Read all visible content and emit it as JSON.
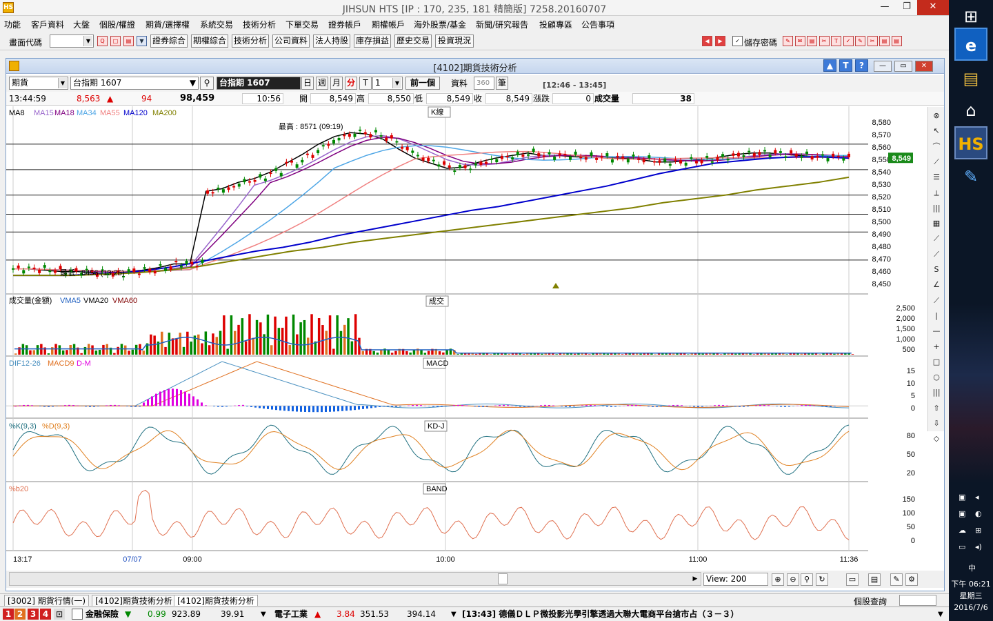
{
  "window": {
    "title": "JIHSUN HTS     [IP : 170, 235, 181 精簡版] 7258.20160707",
    "logo": "HS"
  },
  "menu": [
    "功能",
    "客戶資料",
    "大盤",
    "個股/權證",
    "期貨/選擇權",
    "系統交易",
    "技術分析",
    "下單交易",
    "證券帳戶",
    "期權帳戶",
    "海外股票/基金",
    "新聞/研究報告",
    "投顧專區",
    "公告事項"
  ],
  "toolbar": {
    "code_label": "畫面代碼",
    "buttons": [
      "證券綜合",
      "期權綜合",
      "技術分析",
      "公司資料",
      "法人持股",
      "庫存損益",
      "歷史交易",
      "投資現況"
    ],
    "save_pw_label": "儲存密碼"
  },
  "chart_window": {
    "title": "[4102]期貨技術分析",
    "help_buttons": [
      "▲",
      "T",
      "?"
    ],
    "controls": {
      "market": "期貨",
      "symbol": "台指期 1607",
      "symbol_display": "台指期 1607",
      "periods": [
        "日",
        "週",
        "月",
        "分",
        "T"
      ],
      "interval": "1",
      "prev_button": "前一個",
      "data_label": "資料",
      "data_count": "360",
      "unit_button": "筆",
      "time_range": "[12:46 - 13:45]"
    },
    "quote": {
      "time": "13:44:59",
      "price": "8,563",
      "change": "94",
      "volume_total": "98,459",
      "bar_time": "10:56",
      "open_label": "開",
      "open": "8,549",
      "high_label": "高",
      "high": "8,550",
      "low_label": "低",
      "low": "8,549",
      "close_label": "收",
      "close": "8,549",
      "chg_label": "漲跌",
      "chg": "0",
      "vol_label": "成交量",
      "vol": "38"
    },
    "panels": {
      "k": {
        "tag": "K線",
        "ma_legend": [
          {
            "name": "MA8",
            "color": "#000000"
          },
          {
            "name": "MA15",
            "color": "#9966cc"
          },
          {
            "name": "MA18",
            "color": "#800080"
          },
          {
            "name": "MA34",
            "color": "#4ea6e6"
          },
          {
            "name": "MA55",
            "color": "#f08080"
          },
          {
            "name": "MA120",
            "color": "#0000cc"
          },
          {
            "name": "MA200",
            "color": "#808000"
          }
        ],
        "high_note": "最高 : 8571 (09:19)",
        "low_note": "最低 : 8456 (13:26)",
        "y_ticks": [
          "8,580",
          "8,570",
          "8,560",
          "8,550",
          "8,540",
          "8,530",
          "8,520",
          "8,510",
          "8,500",
          "8,490",
          "8,480",
          "8,470",
          "8,460",
          "8,450"
        ],
        "last_price_tag": "8,549"
      },
      "vol": {
        "tag": "成交",
        "legend": [
          {
            "name": "成交量(金額)",
            "color": "#000000"
          },
          {
            "name": "VMA5",
            "color": "#2060c0"
          },
          {
            "name": "VMA20",
            "color": "#000000"
          },
          {
            "name": "VMA60",
            "color": "#800000"
          }
        ],
        "y_ticks": [
          "2,500",
          "2,000",
          "1,500",
          "1,000",
          "500"
        ]
      },
      "macd": {
        "tag": "MACD",
        "legend": [
          {
            "name": "DIF12-26",
            "color": "#4a90c0"
          },
          {
            "name": "MACD9",
            "color": "#e07020"
          },
          {
            "name": "D-M",
            "color": "#e000e0"
          }
        ],
        "y_ticks": [
          "15",
          "10",
          "5",
          "0"
        ]
      },
      "kd": {
        "tag": "KD-J",
        "legend": [
          {
            "name": "%K(9,3)",
            "color": "#207080"
          },
          {
            "name": "%D(9,3)",
            "color": "#e08020"
          }
        ],
        "y_ticks": [
          "80",
          "50",
          "20"
        ]
      },
      "band": {
        "tag": "BAND",
        "legend": [
          {
            "name": "%b20",
            "color": "#e07050"
          }
        ],
        "y_ticks": [
          "150",
          "100",
          "50",
          "0"
        ]
      }
    },
    "x_ticks": [
      "13:17",
      "07/07",
      "09:00",
      "10:00",
      "11:00",
      "11:36"
    ],
    "view_label": "View: 200"
  },
  "tabs": [
    "[3002] 期貨行情(一)",
    "[4102]期貨技術分析",
    "[4102]期貨技術分析"
  ],
  "stock_query_label": "個股查詢",
  "status": {
    "pages": [
      "1",
      "2",
      "3",
      "4"
    ],
    "item1_name": "金融保險",
    "item1_arrow": "▼",
    "item1_chg": "0.99",
    "item1_idx": "923.89",
    "item1_val": "39.91",
    "item2_name": "電子工業",
    "item2_arrow": "▲",
    "item2_chg": "3.84",
    "item2_idx": "351.53",
    "item2_val": "394.14",
    "news": "[13:43] 德儀ＤＬＰ微投影光學引擎透過大聯大電商平台搶市占（３－３）"
  },
  "taskbar": {
    "time": "下午 06:21",
    "weekday": "星期三",
    "date": "2016/7/6",
    "ime": "中"
  },
  "chart_data": {
    "type": "candlestick",
    "x_labels": [
      "13:17",
      "07/07",
      "09:00",
      "10:00",
      "11:00",
      "11:36"
    ],
    "price_range": [
      8450,
      8580
    ],
    "high": {
      "value": 8571,
      "time": "09:19"
    },
    "low": {
      "value": 8456,
      "time": "13:26"
    },
    "last": 8549,
    "price_path": [
      8462,
      8462,
      8461,
      8460,
      8460,
      8459,
      8458,
      8460,
      8461,
      8463,
      8466,
      8466,
      8523,
      8525,
      8530,
      8533,
      8538,
      8545,
      8552,
      8560,
      8566,
      8569,
      8568,
      8564,
      8556,
      8549,
      8545,
      8541,
      8542,
      8546,
      8549,
      8551,
      8553,
      8551,
      8551,
      8550,
      8550,
      8549,
      8549,
      8548,
      8546,
      8546,
      8547,
      8548,
      8550,
      8552,
      8553,
      8553,
      8552,
      8551,
      8550,
      8550,
      8549
    ],
    "ma120_path": [
      8457,
      8457,
      8457,
      8458,
      8459,
      8461,
      8464,
      8468,
      8472,
      8476,
      8479,
      8483,
      8488,
      8492,
      8496,
      8500,
      8504,
      8508,
      8511,
      8515,
      8519,
      8523,
      8527,
      8532,
      8537,
      8541,
      8545,
      8547,
      8549,
      8550,
      8550,
      8549
    ],
    "ma200_path": [
      8457,
      8457,
      8457,
      8458,
      8459,
      8461,
      8464,
      8468,
      8472,
      8476,
      8479,
      8483,
      8486,
      8489,
      8492,
      8495,
      8498,
      8501,
      8504,
      8507,
      8510,
      8514,
      8517,
      8520,
      8524,
      8527,
      8530,
      8534
    ],
    "volume_y_range": [
      0,
      2500
    ],
    "macd_y_range": [
      -3,
      18
    ],
    "kd_y_range": [
      0,
      100
    ],
    "band_y_range": [
      -20,
      180
    ]
  }
}
